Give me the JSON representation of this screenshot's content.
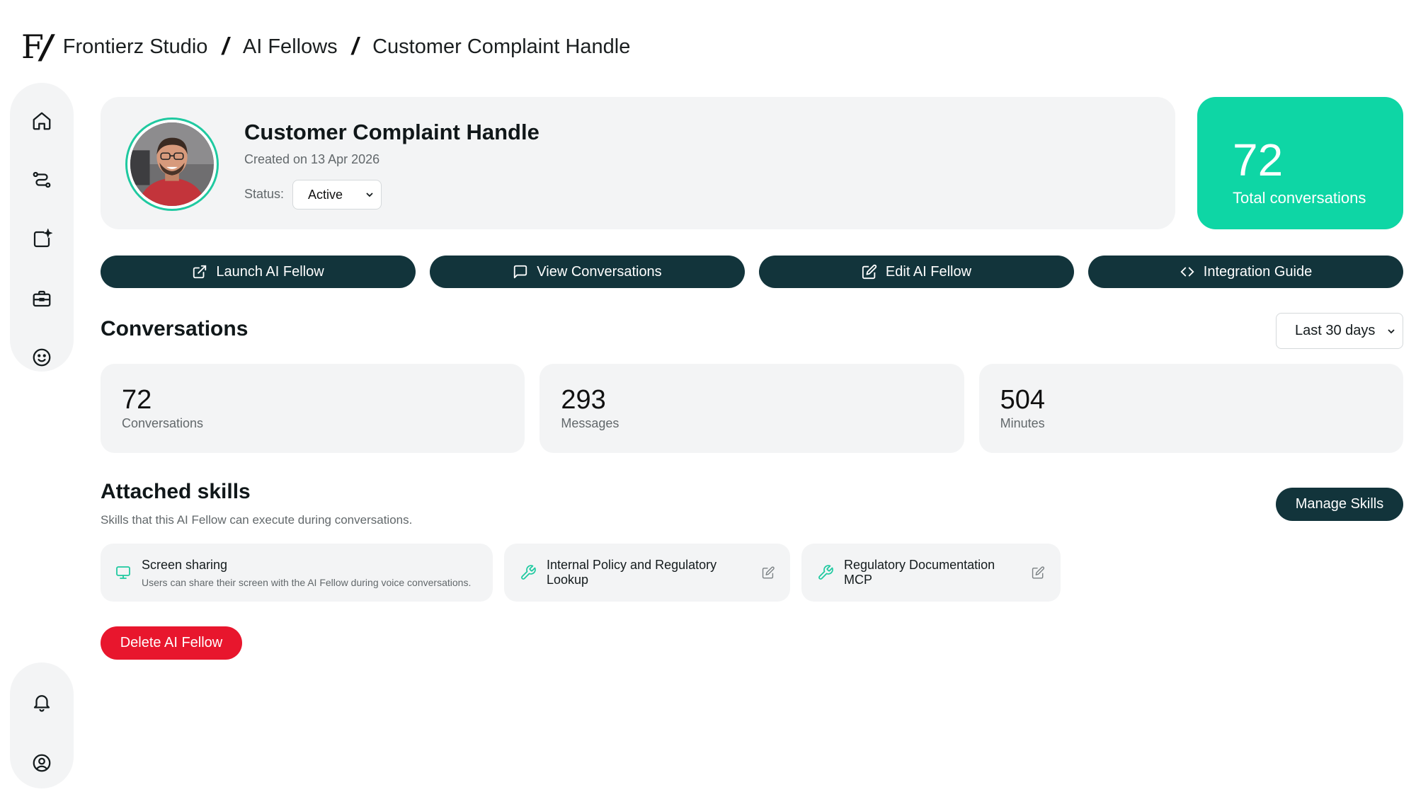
{
  "breadcrumb": {
    "logo": "F",
    "items": [
      "Frontierz Studio",
      "AI Fellows",
      "Customer Complaint Handle"
    ]
  },
  "sidebar": {
    "top_icons": [
      "home-icon",
      "workflow-icon",
      "add-skill-icon",
      "briefcase-icon",
      "smile-icon"
    ],
    "bottom_icons": [
      "bell-icon",
      "user-circle-icon"
    ]
  },
  "profile": {
    "title": "Customer Complaint Handle",
    "created": "Created on 13 Apr 2026",
    "status_label": "Status:",
    "status_value": "Active"
  },
  "total": {
    "value": "72",
    "label": "Total conversations"
  },
  "actions": [
    {
      "label": "Launch AI Fellow",
      "icon": "external-link-icon"
    },
    {
      "label": "View Conversations",
      "icon": "chat-icon"
    },
    {
      "label": "Edit AI Fellow",
      "icon": "edit-icon"
    },
    {
      "label": "Integration Guide",
      "icon": "code-icon"
    }
  ],
  "conversations": {
    "title": "Conversations",
    "range": "Last 30 days",
    "stats": [
      {
        "value": "72",
        "label": "Conversations"
      },
      {
        "value": "293",
        "label": "Messages"
      },
      {
        "value": "504",
        "label": "Minutes"
      }
    ]
  },
  "skills": {
    "title": "Attached skills",
    "subtitle": "Skills that this AI Fellow can execute during conversations.",
    "manage_label": "Manage Skills",
    "items": [
      {
        "name": "Screen sharing",
        "desc": "Users can share their screen with the AI Fellow during voice conversations.",
        "icon": "monitor-icon"
      },
      {
        "name": "Internal Policy and Regulatory Lookup",
        "icon": "wrench-icon"
      },
      {
        "name": "Regulatory Documentation MCP",
        "icon": "wrench-icon"
      }
    ]
  },
  "delete_label": "Delete AI Fellow",
  "colors": {
    "accent": "#0ed6a5",
    "dark_button": "#12343b",
    "danger": "#e8162d",
    "card_bg": "#f3f4f5"
  }
}
